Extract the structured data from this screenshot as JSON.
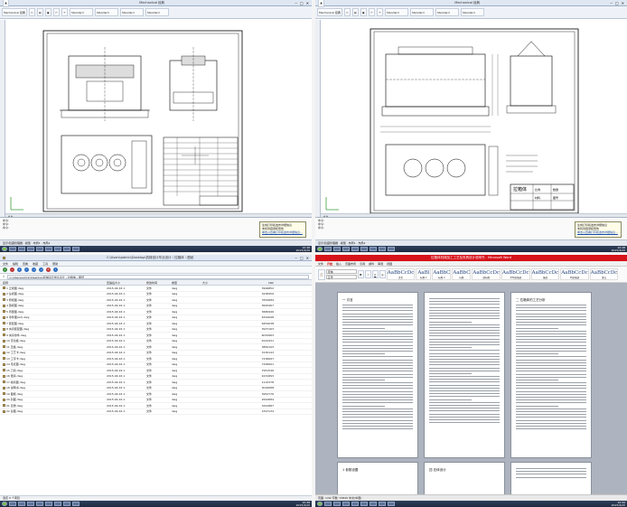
{
  "cad_left": {
    "app_label": "Mechanical 经典",
    "tab_names": [
      "Mechanical 经典",
      "AutoCAD 2010",
      "Standard",
      "Standard",
      "Standard",
      "Standard"
    ],
    "command_lines": [
      "命令:",
      "命令:",
      "命令:"
    ],
    "status_text": "显示/隐藏管理器 · 模型 · 布局1 · 布局2",
    "balloon_title": "生成打印和发布详细信息",
    "balloon_body": "未找到错误和警告",
    "balloon_link": "单击以查看打印和发布详细信息...",
    "taskbar_clock": "10:48",
    "taskbar_date": "2015/4/20"
  },
  "cad_right": {
    "app_label": "Mechanical 经典",
    "tab_names": [
      "Mechanical 经典",
      "AutoCAD 2010",
      "Standard",
      "Standard",
      "Standard",
      "Standard"
    ],
    "command_lines": [
      "命令:",
      "命令:",
      "命令:"
    ],
    "status_text": "显示/隐藏管理器 · 模型 · 布局1 · 布局2",
    "balloon_title": "生成打印和发布详细信息",
    "balloon_body": "未找到错误和警告",
    "balloon_link": "单击以查看打印和发布详细信息...",
    "title_block": [
      "拉箱体",
      "比例",
      "数量",
      "材料",
      "图号"
    ],
    "taskbar_clock": "10:48",
    "taskbar_date": "2015/4/20"
  },
  "explorer": {
    "menu": [
      "文件",
      "编辑",
      "查看",
      "收藏",
      "工具",
      "帮助"
    ],
    "address": "C:\\Users\\admin\\Desktop\\机械设计毕业设计 › 拉箱体 › 图纸",
    "columns": [
      "名称",
      "压缩后大小",
      "修改时间",
      "类型",
      "大小",
      "CRC"
    ],
    "files": [
      [
        "1 正视图.dwg",
        "2015-04-16 1",
        "文件",
        "dwg",
        "3999852"
      ],
      [
        "2 左视图.dwg",
        "2015-04-16 1",
        "文件",
        "dwg",
        "3238459"
      ],
      [
        "3 俯视图.dwg",
        "2015-04-16 1",
        "文件",
        "dwg",
        "7832684"
      ],
      [
        "4 剖视图.dwg",
        "2015-04-16 1",
        "文件",
        "dwg",
        "3645467"
      ],
      [
        "5 局部图.dwg",
        "2015-04-16 1",
        "文件",
        "dwg",
        "3680946"
      ],
      [
        "6 零件图(A2).dwg",
        "2015-04-16 1",
        "文件",
        "dwg",
        "6344098"
      ],
      [
        "7 装配图.dwg",
        "2015-04-16 1",
        "文件",
        "dwg",
        "6454038"
      ],
      [
        "8 夹具装配图.dwg",
        "2015-04-16 1",
        "文件",
        "dwg",
        "3937163"
      ],
      [
        "9 夹具零件.dwg",
        "2015-04-16 1",
        "文件",
        "dwg",
        "6032963"
      ],
      [
        "10 定位板.dwg",
        "2015-04-16 1",
        "文件",
        "dwg",
        "6142431"
      ],
      [
        "11 压板.dwg",
        "2015-04-16 1",
        "文件",
        "dwg",
        "3850193"
      ],
      [
        "12 工艺卡.dwg",
        "2015-04-16 1",
        "文件",
        "dwg",
        "3130143"
      ],
      [
        "13 工序卡.dwg",
        "2015-04-16 1",
        "文件",
        "dwg",
        "7236697"
      ],
      [
        "14 毛坯图.dwg",
        "2015-04-16 1",
        "文件",
        "dwg",
        "7328991"
      ],
      [
        "15 刀具.dwg",
        "2015-04-16 1",
        "文件",
        "dwg",
        "7951546"
      ],
      [
        "16 量具.dwg",
        "2015-04-16 1",
        "文件",
        "dwg",
        "4231893"
      ],
      [
        "17 模具图.dwg",
        "2015-04-16 1",
        "文件",
        "dwg",
        "1115378"
      ],
      [
        "18 说明书.dwg",
        "2015-04-16 1",
        "文件",
        "dwg",
        "3016088"
      ],
      [
        "19 图框.dwg",
        "2015-04-16 1",
        "文件",
        "dwg",
        "3952776"
      ],
      [
        "20 封面.dwg",
        "2015-04-16 1",
        "文件",
        "dwg",
        "2644684"
      ],
      [
        "21 目录.dwg",
        "2015-04-16 1",
        "文件",
        "dwg",
        "3291887"
      ],
      [
        "22 总图.dwg",
        "2015-04-16 1",
        "文件",
        "dwg",
        "1597134"
      ]
    ],
    "status": "选定 0 个项目",
    "taskbar_clock": "10:48",
    "taskbar_date": "2015/4/20"
  },
  "word": {
    "title": "拉箱体机械加工工艺及夹具设计说明书 - Microsoft Word",
    "tabs": [
      "文件",
      "开始",
      "插入",
      "页面布局",
      "引用",
      "邮件",
      "审阅",
      "视图"
    ],
    "font_name": "宋体",
    "font_size": "五号",
    "styles": [
      {
        "sample": "AaBbCcDc",
        "name": "正文"
      },
      {
        "sample": "AaBl",
        "name": "标题 1"
      },
      {
        "sample": "AaBbC",
        "name": "标题 2"
      },
      {
        "sample": "AaBbC",
        "name": "标题"
      },
      {
        "sample": "AaBbCcDc",
        "name": "副标题"
      },
      {
        "sample": "AaBbCcDc",
        "name": "不明显强调"
      },
      {
        "sample": "AaBbCcDc",
        "name": "强调"
      },
      {
        "sample": "AaBbCcDc",
        "name": "明显强调"
      },
      {
        "sample": "AaBbCcDc",
        "name": "要点"
      }
    ],
    "page1_heading": "一 引言",
    "page3_heading": "二 拉箱体的工艺分析",
    "page4_heading": "1 参数设置",
    "page5_heading": "四 总体设计",
    "status": "页面: 1/32  字数: 15820  中文(中国)",
    "taskbar_clock": "10:49",
    "taskbar_date": "2015/4/20"
  }
}
